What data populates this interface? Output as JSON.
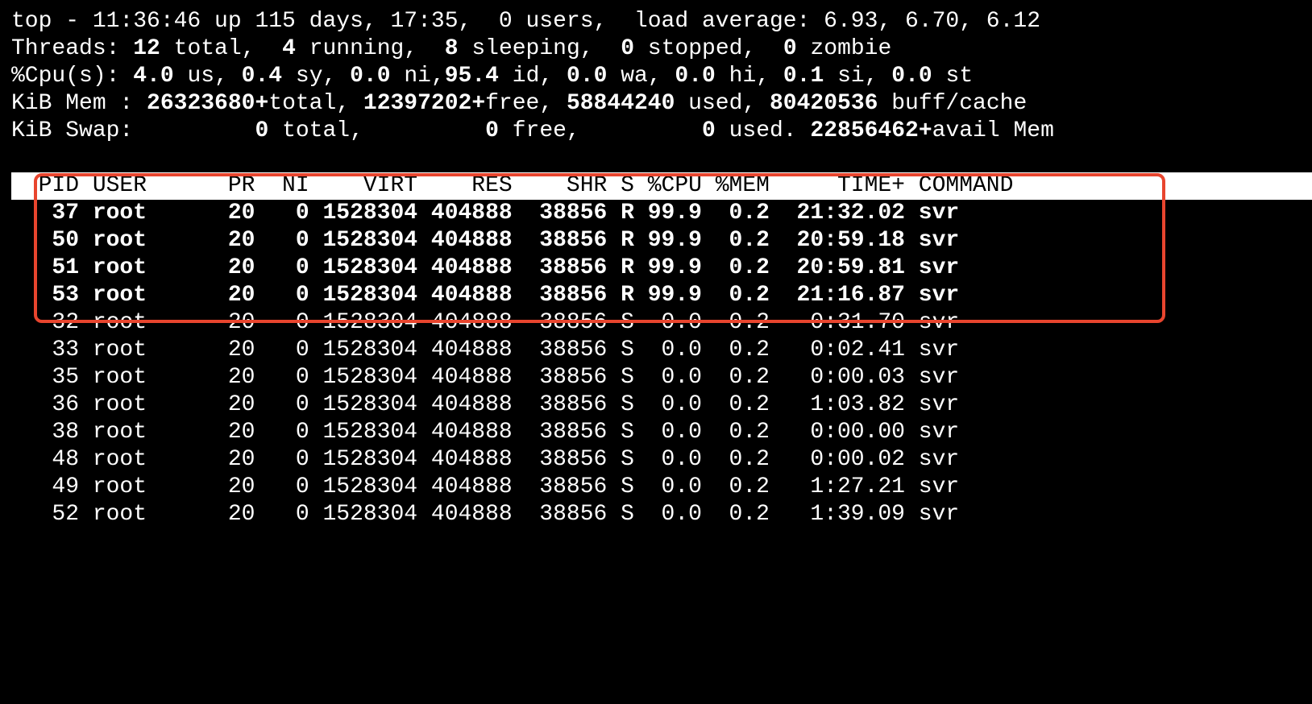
{
  "summary": {
    "line1": "top - 11:36:46 up 115 days, 17:35,  0 users,  load average: 6.93, 6.70, 6.12",
    "threads": {
      "label": "Threads: ",
      "total": "12",
      "total_label": " total,  ",
      "running": "4",
      "running_label": " running,  ",
      "sleeping": "8",
      "sleeping_label": " sleeping,  ",
      "stopped": "0",
      "stopped_label": " stopped,  ",
      "zombie": "0",
      "zombie_label": " zombie"
    },
    "cpu": {
      "label": "%Cpu(s): ",
      "us": "4.0",
      "us_label": " us, ",
      "sy": "0.4",
      "sy_label": " sy, ",
      "ni": "0.0",
      "ni_label": " ni,",
      "id": "95.4",
      "id_label": " id, ",
      "wa": "0.0",
      "wa_label": " wa, ",
      "hi": "0.0",
      "hi_label": " hi, ",
      "si": "0.1",
      "si_label": " si, ",
      "st": "0.0",
      "st_label": " st"
    },
    "mem": {
      "label": "KiB Mem : ",
      "total": "26323680+",
      "total_label": "total, ",
      "free": "12397202+",
      "free_label": "free, ",
      "used": "58844240",
      "used_label": " used, ",
      "buff": "80420536",
      "buff_label": " buff/cache"
    },
    "swap": {
      "label": "KiB Swap:         ",
      "total": "0",
      "total_label": " total,         ",
      "free": "0",
      "free_label": " free,         ",
      "used": "0",
      "used_label": " used. ",
      "avail": "22856462+",
      "avail_label": "avail Mem"
    }
  },
  "table": {
    "header": "  PID USER      PR  NI    VIRT    RES    SHR S %CPU %MEM     TIME+ COMMAND",
    "rows": [
      "   37 root      20   0 1528304 404888  38856 R 99.9  0.2  21:32.02 svr",
      "   50 root      20   0 1528304 404888  38856 R 99.9  0.2  20:59.18 svr",
      "   51 root      20   0 1528304 404888  38856 R 99.9  0.2  20:59.81 svr",
      "   53 root      20   0 1528304 404888  38856 R 99.9  0.2  21:16.87 svr",
      "   32 root      20   0 1528304 404888  38856 S  0.0  0.2   0:31.70 svr",
      "   33 root      20   0 1528304 404888  38856 S  0.0  0.2   0:02.41 svr",
      "   35 root      20   0 1528304 404888  38856 S  0.0  0.2   0:00.03 svr",
      "   36 root      20   0 1528304 404888  38856 S  0.0  0.2   1:03.82 svr",
      "   38 root      20   0 1528304 404888  38856 S  0.0  0.2   0:00.00 svr",
      "   48 root      20   0 1528304 404888  38856 S  0.0  0.2   0:00.02 svr",
      "   49 root      20   0 1528304 404888  38856 S  0.0  0.2   1:27.21 svr",
      "   52 root      20   0 1528304 404888  38856 S  0.0  0.2   1:39.09 svr"
    ]
  },
  "colors": {
    "background": "#000000",
    "text": "#ffffff",
    "header_bg": "#ffffff",
    "header_text": "#000000",
    "highlight": "#e8452e"
  }
}
